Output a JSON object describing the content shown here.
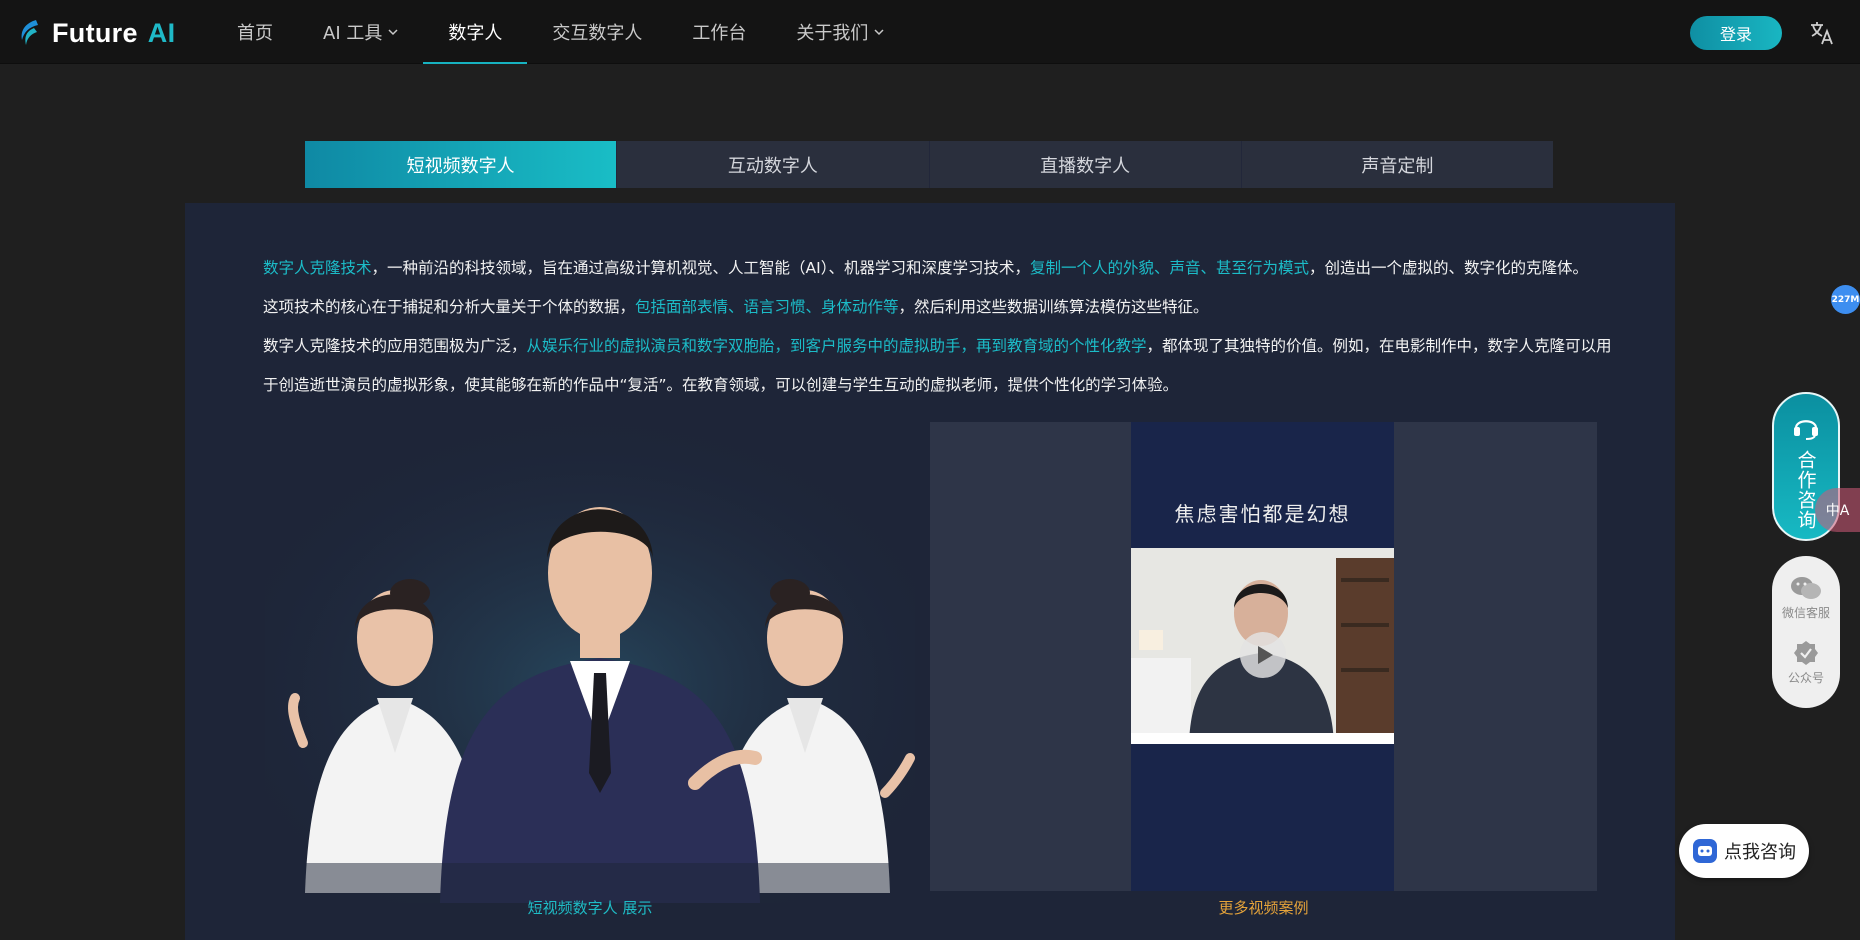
{
  "header": {
    "logo_text": "Future",
    "logo_ai": "AI",
    "nav": [
      {
        "label": "首页"
      },
      {
        "label": "AI 工具"
      },
      {
        "label": "数字人"
      },
      {
        "label": "交互数字人"
      },
      {
        "label": "工作台"
      },
      {
        "label": "关于我们"
      }
    ],
    "login_label": "登录",
    "translate_icon": "translate-icon"
  },
  "tabs": [
    {
      "label": "短视频数字人"
    },
    {
      "label": "互动数字人"
    },
    {
      "label": "直播数字人"
    },
    {
      "label": "声音定制"
    }
  ],
  "description": {
    "p1_hl1": "数字人克隆技术",
    "p1_t1": "，一种前沿的科技领域，旨在通过高级计算机视觉、人工智能（AI）、机器学习和深度学习技术，",
    "p1_hl2": "复制一个人的外貌、声音、甚至行为模式",
    "p1_t2": "，创造出一个虚拟的、数字化的克隆体。",
    "p2_t1": "这项技术的核心在于捕捉和分析大量关于个体的数据，",
    "p2_hl1": "包括面部表情、语言习惯、身体动作等",
    "p2_t2": "，然后利用这些数据训练算法模仿这些特征。",
    "p3_t1": "数字人克隆技术的应用范围极为广泛，",
    "p3_hl1": "从娱乐行业的虚拟演员和数字双胞胎，到客户服务中的虚拟助手，再到教育域的个性化教学",
    "p3_t2": "，都体现了其独特的价值。例如，在电影制作中，数字人克隆可以用于创造逝世演员的虚拟形象，使其能够在新的作品中“复活”。在教育领域，可以创建与学生互动的虚拟老师，提供个性化的学习体验。"
  },
  "media": {
    "left_caption": "短视频数字人 展示",
    "video_title": "焦虑害怕都是幻想",
    "right_caption": "更多视频案例"
  },
  "floating": {
    "memory_badge": "227M",
    "coop_label": "合作咨询",
    "wechat_label": "微信客服",
    "official_label": "公众号",
    "lang_toggle": "中A",
    "consult_label": "点我咨询"
  },
  "colors": {
    "accent": "#17b2c0",
    "highlight_text": "#1cbcc8",
    "orange_caption": "#e5a33a",
    "panel_bg": "#1e2538"
  }
}
